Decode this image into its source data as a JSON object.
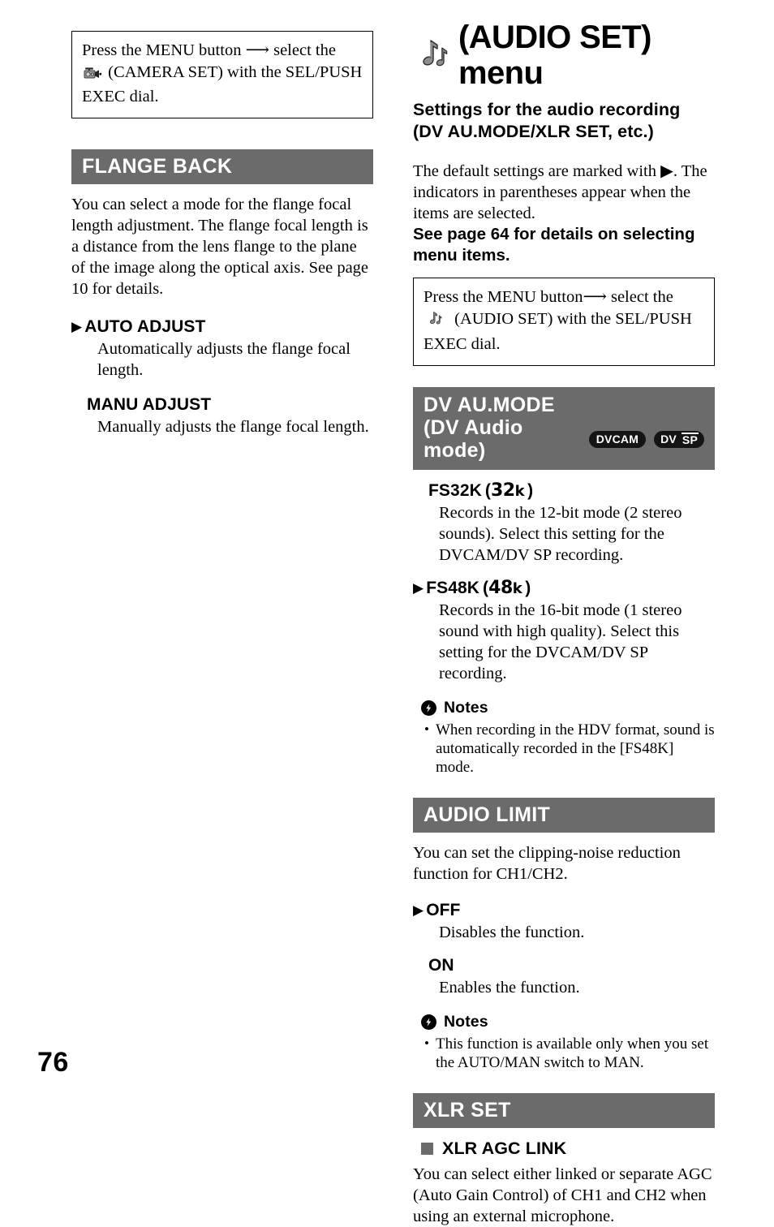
{
  "page": {
    "number": "76",
    "accent_grey": "#6b6b6b",
    "badge_black": "#141414"
  },
  "left_column": {
    "instruction_box": {
      "line1_before": "Press the MENU button",
      "arrow": "→",
      "line1_after": " select the",
      "icon": "camcorder-icon",
      "line2": "(CAMERA SET) with the SEL/PUSH",
      "line3": "EXEC dial."
    },
    "section": {
      "bar_title": "FLANGE BACK",
      "body": "You can select a mode for the flange focal length adjustment. The flange focal length is a distance from the lens flange to the plane of the image along the optical axis. See page 10 for details.",
      "options": [
        {
          "marker": "▶",
          "is_default": true,
          "label": "AUTO ADJUST",
          "desc": "Automatically adjusts the flange focal length."
        },
        {
          "marker": "",
          "is_default": false,
          "label": "MANU ADJUST",
          "desc": "Manually adjusts the flange focal length."
        }
      ]
    }
  },
  "right_column": {
    "title": {
      "icon": "double-music-note-icon",
      "text": "(AUDIO SET) menu"
    },
    "subtitle": "Settings for the audio recording (DV AU.MODE/XLR SET, etc.)",
    "lead_paragraph": "The default settings are marked with ▶. The indicators in parentheses appear when the items are selected.",
    "see_page": "See page 64 for details on selecting menu items.",
    "instruction_box": {
      "line1_before": "Press the MENU button",
      "arrow": "→",
      "line1_after": " select the",
      "icon": "double-music-note-icon",
      "line2": "(AUDIO SET) with the SEL/PUSH",
      "line3": "EXEC dial."
    },
    "sections": [
      {
        "id": "dv-au-mode",
        "bar_title_line1": "DV AU.MODE",
        "bar_title_line2": "(DV Audio mode)",
        "badges": [
          {
            "name": "dvcam-badge",
            "text": "DVCAM"
          },
          {
            "name": "dv-sp-badge",
            "text_dv": "DV",
            "text_sp": "SP"
          }
        ],
        "options": [
          {
            "marker": "",
            "is_default": false,
            "label": "FS32K",
            "indicator_num": "32",
            "indicator_unit": "k",
            "desc": "Records in the 12-bit mode (2 stereo sounds). Select this setting for the DVCAM/DV SP recording."
          },
          {
            "marker": "▶",
            "is_default": true,
            "label": "FS48K",
            "indicator_num": "48",
            "indicator_unit": "k",
            "desc": "Records in the 16-bit mode (1 stereo sound with high quality). Select this setting for the DVCAM/DV SP recording."
          }
        ],
        "notes": {
          "icon": "note-lightning-icon",
          "label": "Notes",
          "items": [
            "When recording in the HDV format, sound is automatically recorded in the [FS48K] mode."
          ]
        }
      },
      {
        "id": "audio-limit",
        "bar_title": "AUDIO LIMIT",
        "body": "You can set the clipping-noise reduction function for CH1/CH2.",
        "options": [
          {
            "marker": "▶",
            "is_default": true,
            "label": "OFF",
            "desc": "Disables the function."
          },
          {
            "marker": "",
            "is_default": false,
            "label": "ON",
            "desc": "Enables the function."
          }
        ],
        "notes": {
          "icon": "note-lightning-icon",
          "label": "Notes",
          "items": [
            "This function is available only when you set the AUTO/MAN switch to MAN."
          ]
        }
      },
      {
        "id": "xlr-set",
        "bar_title": "XLR SET",
        "sub_item": {
          "bullet": "square-bullet-icon",
          "label": "XLR AGC LINK"
        },
        "body": "You can select either linked or separate AGC (Auto Gain Control) of CH1 and CH2 when using an external microphone."
      }
    ]
  }
}
